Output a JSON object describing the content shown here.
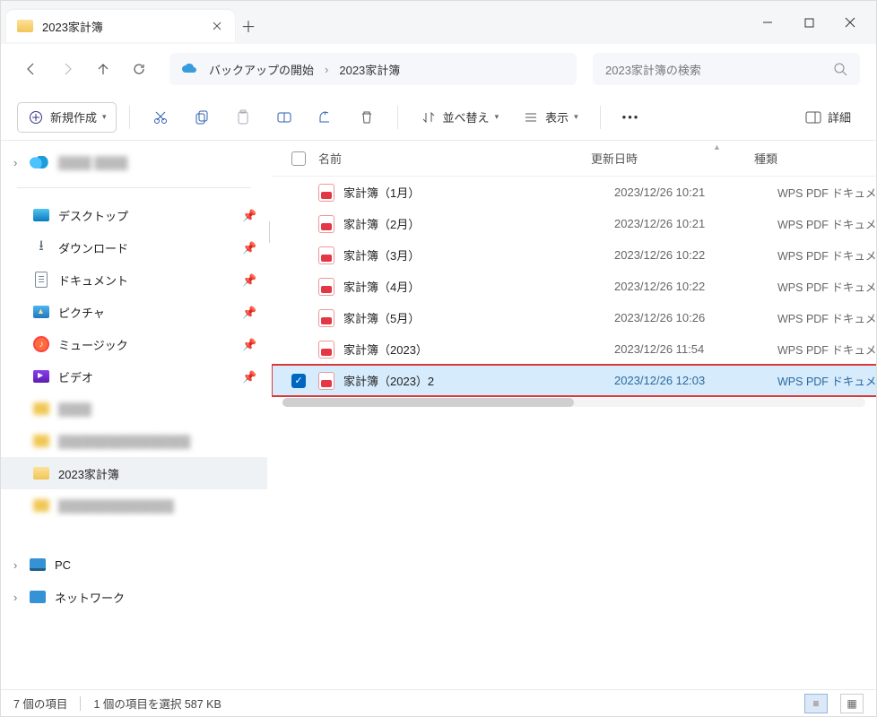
{
  "window": {
    "tab_title": "2023家計簿"
  },
  "nav": {
    "backup_label": "バックアップの開始",
    "path_current": "2023家計簿",
    "search_placeholder": "2023家計簿の検索"
  },
  "toolbar": {
    "new_label": "新規作成",
    "sort_label": "並べ替え",
    "view_label": "表示",
    "details_label": "詳細"
  },
  "sidebar": {
    "onedrive_label": "",
    "quick": [
      {
        "label": "デスクトップ"
      },
      {
        "label": "ダウンロード"
      },
      {
        "label": "ドキュメント"
      },
      {
        "label": "ピクチャ"
      },
      {
        "label": "ミュージック"
      },
      {
        "label": "ビデオ"
      }
    ],
    "current_folder": "2023家計簿",
    "pc_label": "PC",
    "network_label": "ネットワーク"
  },
  "columns": {
    "name": "名前",
    "modified": "更新日時",
    "type": "種類"
  },
  "files": [
    {
      "name": "家計簿（1月）",
      "date": "2023/12/26 10:21",
      "type": "WPS PDF ドキュメント",
      "selected": false
    },
    {
      "name": "家計簿（2月）",
      "date": "2023/12/26 10:21",
      "type": "WPS PDF ドキュメント",
      "selected": false
    },
    {
      "name": "家計簿（3月）",
      "date": "2023/12/26 10:22",
      "type": "WPS PDF ドキュメント",
      "selected": false
    },
    {
      "name": "家計簿（4月）",
      "date": "2023/12/26 10:22",
      "type": "WPS PDF ドキュメント",
      "selected": false
    },
    {
      "name": "家計簿（5月）",
      "date": "2023/12/26 10:26",
      "type": "WPS PDF ドキュメント",
      "selected": false
    },
    {
      "name": "家計簿（2023）",
      "date": "2023/12/26 11:54",
      "type": "WPS PDF ドキュメント",
      "selected": false
    },
    {
      "name": "家計簿（2023）2",
      "date": "2023/12/26 12:03",
      "type": "WPS PDF ドキュメント",
      "selected": true
    }
  ],
  "status": {
    "item_count": "7 個の項目",
    "selection": "1 個の項目を選択 587 KB"
  }
}
